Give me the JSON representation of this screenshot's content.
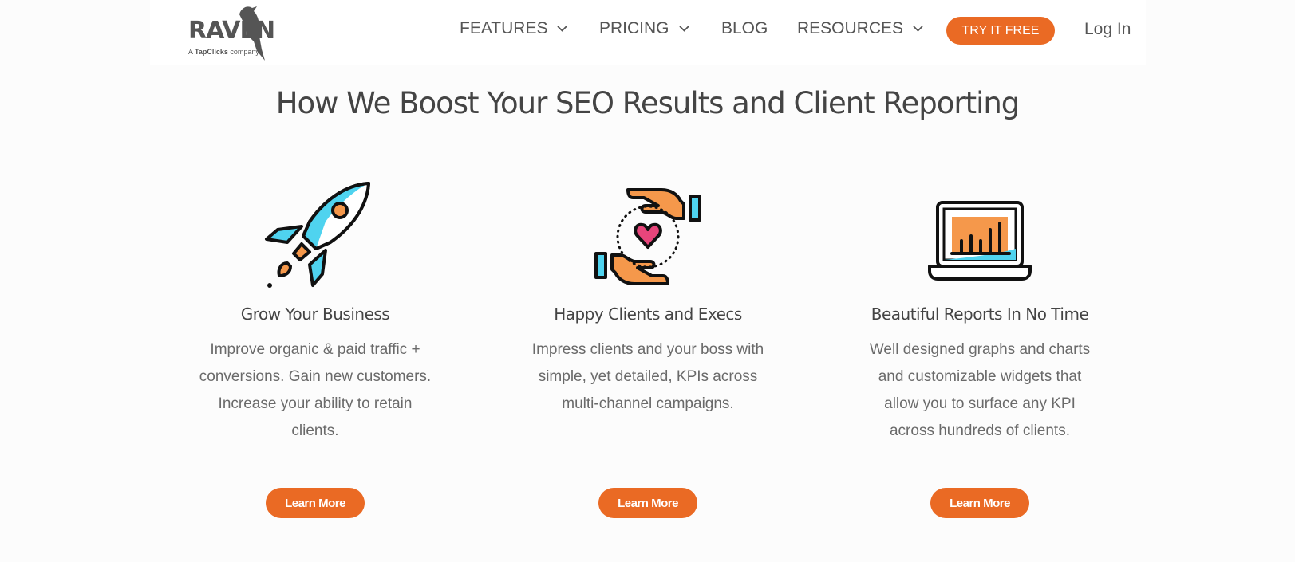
{
  "logo": {
    "word": "RAVEN",
    "tag_prefix": "A",
    "tag_brand": "TapClicks",
    "tag_suffix": "company"
  },
  "nav": {
    "features": "FEATURES",
    "pricing": "PRICING",
    "blog": "BLOG",
    "resources": "RESOURCES",
    "try_free": "TRY IT FREE",
    "login": "Log In"
  },
  "colors": {
    "accent": "#ea6a24",
    "cyan": "#4fd3ef",
    "orange": "#f5984b",
    "pink": "#e8457b"
  },
  "headline": "How We Boost Your SEO Results and Client Reporting",
  "features": [
    {
      "icon": "rocket-icon",
      "title": "Grow Your Business",
      "desc": "Improve organic & paid traffic + conversions. Gain new customers. Increase your ability to retain clients.",
      "button": "Learn More"
    },
    {
      "icon": "hands-heart-icon",
      "title": "Happy Clients and Execs",
      "desc": "Impress clients and your boss with simple, yet detailed, KPIs across multi-channel campaigns.",
      "button": "Learn More"
    },
    {
      "icon": "laptop-chart-icon",
      "title": "Beautiful Reports In No Time",
      "desc": "Well designed graphs and charts and customizable widgets that allow you to surface any KPI across hundreds of clients.",
      "button": "Learn More"
    }
  ]
}
